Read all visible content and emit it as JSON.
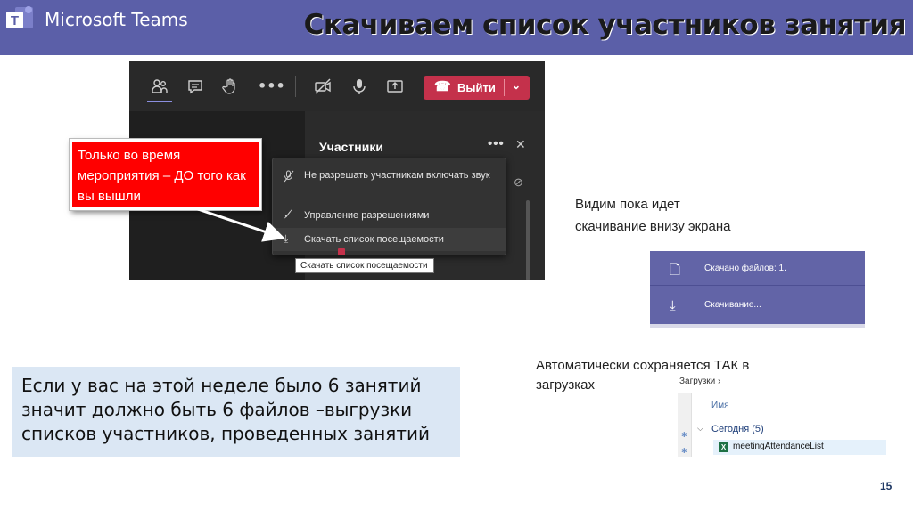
{
  "header": {
    "brand": "Microsoft Teams",
    "title": "Скачиваем список участников занятия",
    "logo_letter": "T"
  },
  "teams_window": {
    "toolbar_icons": [
      "participants-icon",
      "chat-icon",
      "raise-hand-icon",
      "more-icon",
      "camera-off-icon",
      "mic-icon",
      "share-icon"
    ],
    "leave_button": "Выйти",
    "panel_title": "Участники",
    "menu": [
      {
        "icon": "mic-off-icon",
        "label": "Не разрешать участникам включать звук"
      },
      {
        "icon": "manage-permissions-icon",
        "label": "Управление разрешениями"
      },
      {
        "icon": "download-icon",
        "label": "Скачать список посещаемости"
      }
    ],
    "tooltip": "Скачать список посещаемости"
  },
  "callout": {
    "text": "Только во время мероприятия – ДО того как вы вышли"
  },
  "download_caption": "Видим пока идет скачивание внизу экрана",
  "download_panel": {
    "row1": "Скачано файлов: 1.",
    "row2": "Скачивание..."
  },
  "saved_caption": "Автоматически сохраняется ТАК в загрузках",
  "explorer": {
    "breadcrumb": "Загрузки  ›",
    "column_header": "Имя",
    "group": "Сегодня (5)",
    "file_name": "meetingAttendanceList"
  },
  "info_box": "Если у вас на этой неделе было 6 занятий значит должно быть 6 файлов –выгрузки списков участников, проведенных занятий",
  "page_number": "15",
  "colors": {
    "header": "#5b5fa8",
    "callout": "#ff0000",
    "leave": "#c4314b",
    "download_panel": "#6264a7",
    "info_box": "#dbe7f4"
  }
}
